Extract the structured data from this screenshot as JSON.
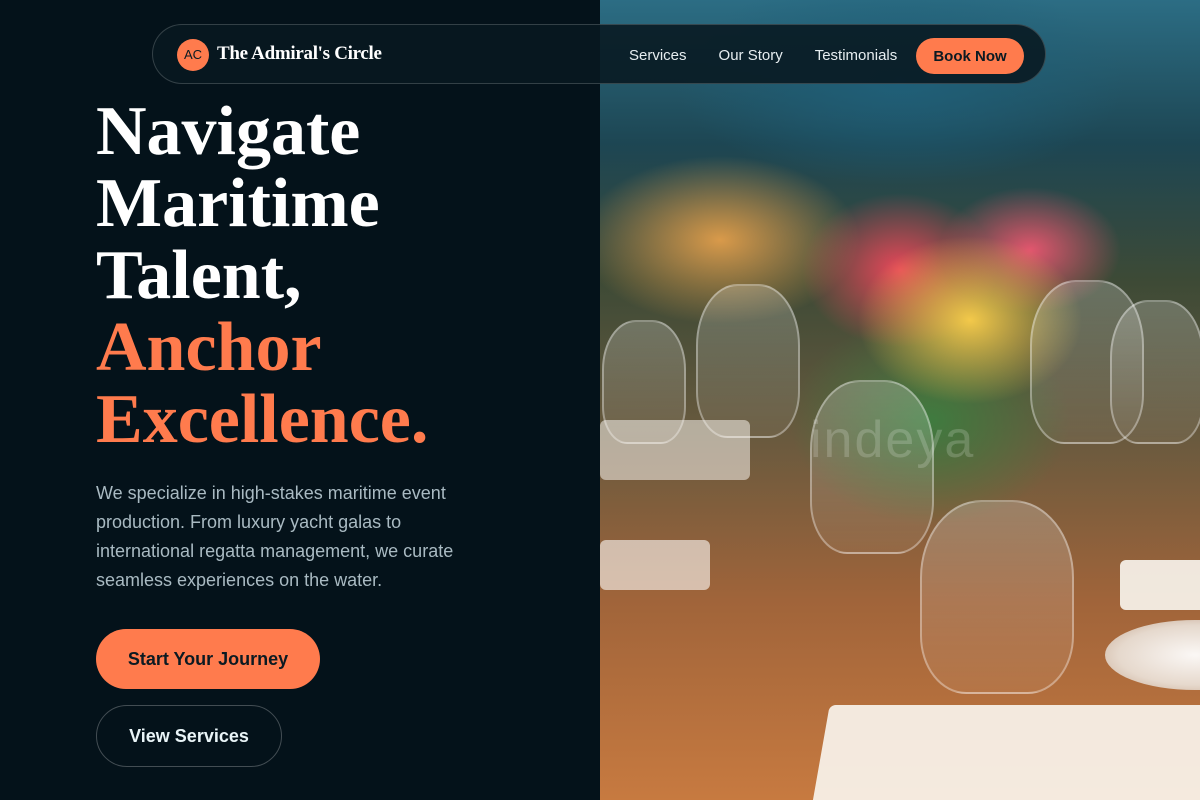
{
  "nav": {
    "logo_initials": "AC",
    "brand": "The Admiral's Circle",
    "links": [
      "Services",
      "Our Story",
      "Testimonials"
    ],
    "cta_label": "Book Now"
  },
  "hero": {
    "headline_lines": [
      "Navigate",
      "Maritime",
      "Talent,"
    ],
    "accent_lines": [
      "Anchor",
      "Excellence."
    ],
    "lead": "We specialize in high-stakes maritime event production. From luxury yacht galas to international regatta management, we curate seamless experiences on the water.",
    "primary_cta": "Start Your Journey",
    "secondary_cta": "View Services"
  },
  "image": {
    "watermark": "indeya"
  },
  "colors": {
    "background": "#04121a",
    "accent": "#ff7b4d",
    "text_primary": "#ffffff",
    "text_muted": "#a9bac2"
  }
}
